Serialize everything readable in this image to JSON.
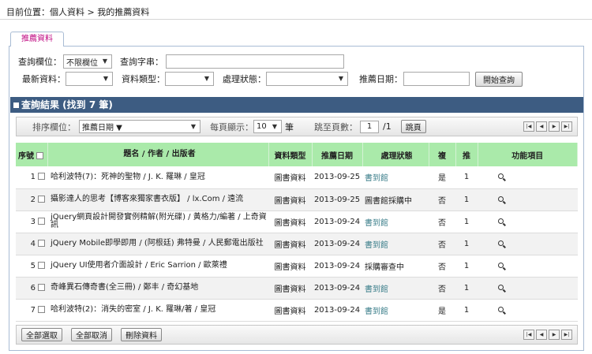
{
  "breadcrumb": "目前位置：個人資料 > 我的推薦資料",
  "tab": "推薦資料",
  "search": {
    "field_label": "查詢欄位：",
    "field_value": "不限欄位",
    "query_label": "查詢字串：",
    "query_value": "",
    "newest_label": "最新資料：",
    "newest_value": "",
    "type_label": "資料類型：",
    "type_value": "",
    "status_label": "處理狀態：",
    "status_value": "",
    "date_label": "推薦日期：",
    "date_value": "",
    "submit": "開始查詢"
  },
  "result_title": "查詢結果 (找到 7 筆)",
  "toolbar": {
    "sort_label": "排序欄位：",
    "sort_value": "推薦日期 ▼",
    "per_page_label": "每頁顯示：",
    "per_page_value": "10",
    "per_page_unit": "筆",
    "jump_label": "跳至頁數：",
    "page_value": "1",
    "total_pages": "/1",
    "jump_button": "跳頁"
  },
  "pager_icons": [
    "first-page-icon",
    "prev-page-icon",
    "next-page-icon",
    "last-page-icon"
  ],
  "pager_glyphs": [
    "|◀",
    "◀",
    "▶",
    "▶|"
  ],
  "columns": {
    "no": "序號",
    "title": "題名 / 作者 / 出版者",
    "type": "資料類型",
    "date": "推薦日期",
    "status": "處理狀態",
    "x": "複",
    "y": "推",
    "fn": "功能項目"
  },
  "rows": [
    {
      "no": "1",
      "title": "哈利波特(7)：死神的聖物 / J. K. 羅琳 / 皇冠",
      "type": "圖書資料",
      "date": "2013-09-25",
      "status": "書到館",
      "status_link": true,
      "x": "是",
      "y": "1"
    },
    {
      "no": "2",
      "title": "攝影達人的思考【博客來獨家書衣版】 / lx.Com / 遠流",
      "type": "圖書資料",
      "date": "2013-09-25",
      "status": "圖書館採購中",
      "status_link": false,
      "x": "否",
      "y": "1"
    },
    {
      "no": "3",
      "title": "jQuery網頁設計開發實例精解(附光碟) / 黃格力/編著 / 上奇資訊",
      "type": "圖書資料",
      "date": "2013-09-24",
      "status": "書到館",
      "status_link": true,
      "x": "否",
      "y": "1"
    },
    {
      "no": "4",
      "title": "jQuery Mobile即學即用 / (阿根廷) 弗特曼 / 人民郵電出版社",
      "type": "圖書資料",
      "date": "2013-09-24",
      "status": "書到館",
      "status_link": true,
      "x": "否",
      "y": "1"
    },
    {
      "no": "5",
      "title": "jQuery UI使用者介面設計 / Eric Sarrion / 歐萊禮",
      "type": "圖書資料",
      "date": "2013-09-24",
      "status": "採購審查中",
      "status_link": false,
      "x": "否",
      "y": "1"
    },
    {
      "no": "6",
      "title": "奇峰異石傳奇書(全三冊) / 鄭丰 / 奇幻基地",
      "type": "圖書資料",
      "date": "2013-09-24",
      "status": "書到館",
      "status_link": true,
      "x": "否",
      "y": "1"
    },
    {
      "no": "7",
      "title": "哈利波特(2)：消失的密室 / J. K. 羅琳/著 / 皇冠",
      "type": "圖書資料",
      "date": "2013-09-24",
      "status": "書到館",
      "status_link": true,
      "x": "是",
      "y": "1"
    }
  ],
  "bottom": {
    "select_all": "全部選取",
    "deselect_all": "全部取消",
    "delete": "刪除資料"
  }
}
